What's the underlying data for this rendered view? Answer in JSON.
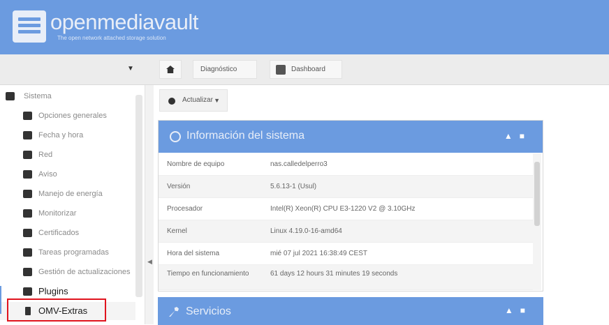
{
  "header": {
    "logo_text": "openmediavault",
    "tagline": "The open network attached storage solution"
  },
  "toolbar": {
    "collapse_icon": "triangle-down",
    "breadcrumbs": [
      {
        "label": "",
        "icon": "home-icon"
      },
      {
        "label": "Diagnóstico"
      },
      {
        "label": "Dashboard",
        "icon": "dashboard-icon"
      }
    ]
  },
  "sidebar": {
    "root": {
      "label": "Sistema",
      "icon": "gear-icon"
    },
    "items": [
      {
        "label": "Opciones generales",
        "icon": "wrench-icon"
      },
      {
        "label": "Fecha y hora",
        "icon": "clock-icon"
      },
      {
        "label": "Red",
        "icon": "network-icon"
      },
      {
        "label": "Aviso",
        "icon": "envelope-icon"
      },
      {
        "label": "Manejo de energía",
        "icon": "battery-icon"
      },
      {
        "label": "Monitorizar",
        "icon": "heart-icon"
      },
      {
        "label": "Certificados",
        "icon": "certificate-icon"
      },
      {
        "label": "Tareas programadas",
        "icon": "calendar-icon"
      },
      {
        "label": "Gestión de actualizaciones",
        "icon": "refresh-icon"
      },
      {
        "label": "Plugins",
        "icon": "puzzle-icon"
      },
      {
        "label": "OMV-Extras",
        "icon": "plug-icon"
      }
    ]
  },
  "main": {
    "update_button": {
      "label": "Actualizar"
    },
    "system_panel": {
      "title": "Información del sistema",
      "rows": [
        {
          "key": "Nombre de equipo",
          "value": "nas.calledelperro3"
        },
        {
          "key": "Versión",
          "value": "5.6.13-1 (Usul)"
        },
        {
          "key": "Procesador",
          "value": "Intel(R) Xeon(R) CPU E3-1220 V2 @ 3.10GHz"
        },
        {
          "key": "Kernel",
          "value": "Linux 4.19.0-16-amd64"
        },
        {
          "key": "Hora del sistema",
          "value": "mié 07 jul 2021 16:38:49 CEST"
        },
        {
          "key": "Tiempo en funcionamiento",
          "value": "61 days 12 hours 31 minutes 19 seconds"
        }
      ]
    },
    "services_panel": {
      "title": "Servicios"
    }
  },
  "colors": {
    "accent": "#6b9be0",
    "highlight": "#e0141e"
  }
}
